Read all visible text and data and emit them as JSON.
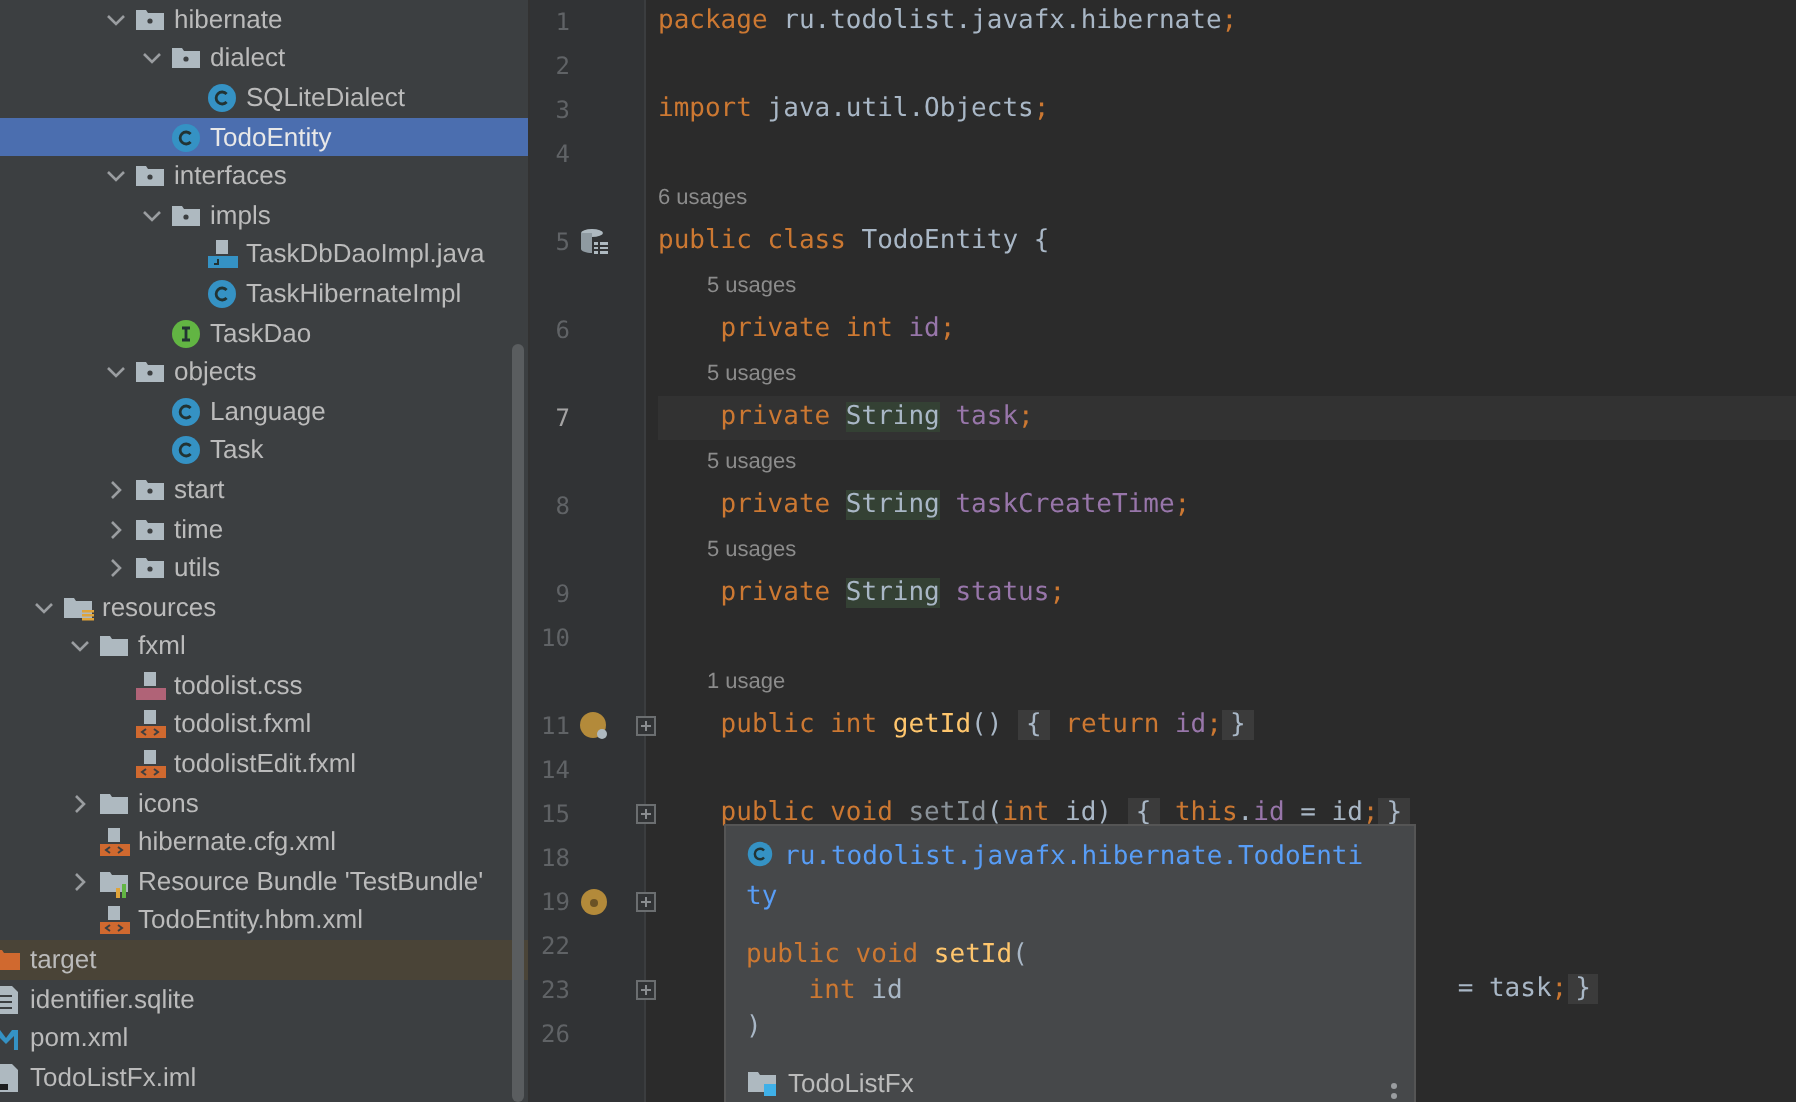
{
  "project_tree": [
    {
      "children": [
        {
          "children": [
            {
              "children": [
                {
                  "children": [
                    {
                      "label": "hibernate",
                      "kind": "package",
                      "expanded": true,
                      "selected": false,
                      "children": [
                        {
                          "label": "dialect",
                          "kind": "package",
                          "expanded": true,
                          "selected": false,
                          "children": [
                            {
                              "label": "SQLiteDialect",
                              "kind": "class",
                              "selected": false
                            }
                          ]
                        },
                        {
                          "label": "TodoEntity",
                          "kind": "class",
                          "selected": true
                        }
                      ]
                    },
                    {
                      "label": "interfaces",
                      "kind": "package",
                      "expanded": true,
                      "selected": false,
                      "children": [
                        {
                          "label": "impls",
                          "kind": "package",
                          "expanded": true,
                          "selected": false,
                          "children": [
                            {
                              "label": "TaskDbDaoImpl.java",
                              "kind": "java-file",
                              "selected": false
                            },
                            {
                              "label": "TaskHibernateImpl",
                              "kind": "class",
                              "selected": false
                            }
                          ]
                        },
                        {
                          "label": "TaskDao",
                          "kind": "interface",
                          "selected": false
                        }
                      ]
                    },
                    {
                      "label": "objects",
                      "kind": "package",
                      "expanded": true,
                      "selected": false,
                      "children": [
                        {
                          "label": "Language",
                          "kind": "class",
                          "selected": false
                        },
                        {
                          "label": "Task",
                          "kind": "class",
                          "selected": false
                        }
                      ]
                    },
                    {
                      "label": "start",
                      "kind": "package",
                      "expanded": false,
                      "selected": false
                    },
                    {
                      "label": "time",
                      "kind": "package",
                      "expanded": false,
                      "selected": false
                    },
                    {
                      "label": "utils",
                      "kind": "package",
                      "expanded": false,
                      "selected": false
                    }
                  ]
                }
              ]
            },
            {
              "label": "resources",
              "kind": "resources-folder",
              "expanded": true,
              "selected": false,
              "children": [
                {
                  "label": "fxml",
                  "kind": "folder",
                  "expanded": true,
                  "selected": false,
                  "children": [
                    {
                      "label": "todolist.css",
                      "kind": "css-file",
                      "selected": false
                    },
                    {
                      "label": "todolist.fxml",
                      "kind": "xml-file",
                      "selected": false
                    },
                    {
                      "label": "todolistEdit.fxml",
                      "kind": "xml-file",
                      "selected": false
                    }
                  ]
                },
                {
                  "label": "icons",
                  "kind": "folder",
                  "expanded": false,
                  "selected": false
                },
                {
                  "label": "hibernate.cfg.xml",
                  "kind": "xml-file",
                  "selected": false
                },
                {
                  "label": "Resource Bundle 'TestBundle'",
                  "kind": "bundle",
                  "expanded": false,
                  "selected": false
                },
                {
                  "label": "TodoEntity.hbm.xml",
                  "kind": "xml-file",
                  "selected": false
                }
              ]
            }
          ]
        }
      ]
    },
    {
      "label": "target",
      "kind": "excluded-folder",
      "selected": false
    },
    {
      "label": "identifier.sqlite",
      "kind": "text-file",
      "selected": false
    },
    {
      "label": "pom.xml",
      "kind": "maven-file",
      "selected": false
    },
    {
      "label": "TodoListFx.iml",
      "kind": "module-file",
      "selected": false
    }
  ],
  "editor": {
    "lines": [
      {
        "number": "1",
        "current": false,
        "folded": false,
        "tokens": [
          {
            "kind": "kw",
            "text": "package"
          },
          {
            "kind": "plain",
            "text": " ru.todolist.javafx.hibernate"
          },
          {
            "kind": "kw",
            "text": ";"
          }
        ]
      },
      {
        "number": "2",
        "current": false,
        "folded": false
      },
      {
        "number": "3",
        "current": false,
        "folded": false,
        "tokens": [
          {
            "kind": "kw",
            "text": "import"
          },
          {
            "kind": "plain",
            "text": " java.util.Objects"
          },
          {
            "kind": "kw",
            "text": ";"
          }
        ]
      },
      {
        "number": "4",
        "current": false,
        "folded": false
      },
      {
        "number": "5",
        "usages": "6 usages",
        "marker": {
          "kind": "table"
        },
        "current": false,
        "folded": false,
        "tokens": [
          {
            "kind": "kw",
            "text": "public class"
          },
          {
            "kind": "plain",
            "text": " TodoEntity {"
          }
        ]
      },
      {
        "number": "6",
        "usages": "5 usages",
        "current": false,
        "folded": false,
        "tokens": [
          {
            "kind": "kw",
            "text": "    private int"
          },
          {
            "kind": "field",
            "text": " id"
          },
          {
            "kind": "kw",
            "text": ";"
          }
        ]
      },
      {
        "number": "7",
        "usages": "5 usages",
        "current": true,
        "folded": false,
        "tokens": [
          {
            "kind": "kw",
            "text": "    private "
          },
          {
            "kind": "type",
            "text": "String"
          },
          {
            "kind": "field",
            "text": " task"
          },
          {
            "kind": "kw",
            "text": ";"
          }
        ]
      },
      {
        "number": "8",
        "usages": "5 usages",
        "current": false,
        "folded": false,
        "tokens": [
          {
            "kind": "kw",
            "text": "    private "
          },
          {
            "kind": "type",
            "text": "String"
          },
          {
            "kind": "field",
            "text": " taskCreateTime"
          },
          {
            "kind": "kw",
            "text": ";"
          }
        ]
      },
      {
        "number": "9",
        "usages": "5 usages",
        "current": false,
        "folded": false,
        "tokens": [
          {
            "kind": "kw",
            "text": "    private "
          },
          {
            "kind": "type",
            "text": "String"
          },
          {
            "kind": "field",
            "text": " status"
          },
          {
            "kind": "kw",
            "text": ";"
          }
        ]
      },
      {
        "number": "10",
        "current": false,
        "folded": false
      },
      {
        "number": "11",
        "usages": "1 usage",
        "marker": {
          "kind": "getter"
        },
        "current": false,
        "folded": true,
        "tokens": [
          {
            "kind": "kw",
            "text": "    public int "
          },
          {
            "kind": "method",
            "text": "getId"
          },
          {
            "kind": "plain",
            "text": "() "
          },
          {
            "kind": "fold",
            "text": "{"
          },
          {
            "kind": "kw",
            "text": " return"
          },
          {
            "kind": "field",
            "text": " id"
          },
          {
            "kind": "kw",
            "text": ";"
          },
          {
            "kind": "fold",
            "text": "}"
          }
        ]
      },
      {
        "number": "14",
        "current": false,
        "folded": false
      },
      {
        "number": "15",
        "current": false,
        "folded": true,
        "tokens": [
          {
            "kind": "kw",
            "text": "    public void "
          },
          {
            "kind": "dim",
            "text": "setId"
          },
          {
            "kind": "plain",
            "text": "("
          },
          {
            "kind": "kw",
            "text": "int"
          },
          {
            "kind": "plain",
            "text": " id) "
          },
          {
            "kind": "fold",
            "text": "{"
          },
          {
            "kind": "kw",
            "text": " this"
          },
          {
            "kind": "plain",
            "text": "."
          },
          {
            "kind": "field",
            "text": "id"
          },
          {
            "kind": "plain",
            "text": " = id"
          },
          {
            "kind": "kw",
            "text": ";"
          },
          {
            "kind": "fold",
            "text": "}"
          }
        ]
      },
      {
        "number": "18",
        "current": false,
        "folded": false
      },
      {
        "number": "19",
        "marker": {
          "kind": "setter"
        },
        "current": false,
        "folded": true
      },
      {
        "number": "22",
        "current": false,
        "folded": false
      },
      {
        "number": "23",
        "current": false,
        "folded": true,
        "tokens": [
          {
            "kind": "after-popup",
            "text": " = task"
          },
          {
            "kind": "kw",
            "text": ";"
          },
          {
            "kind": "fold",
            "text": "}"
          }
        ]
      },
      {
        "number": "26",
        "current": false,
        "folded": false
      }
    ]
  },
  "popup": {
    "qualified_name": "ru.todolist.javafx.hibernate.TodoEntity",
    "signature": [
      [
        {
          "kind": "kw",
          "text": "public void "
        },
        {
          "kind": "method",
          "text": "setId"
        },
        {
          "kind": "plain",
          "text": "("
        }
      ],
      [
        {
          "kind": "kw",
          "text": "    int"
        },
        {
          "kind": "plain",
          "text": " id"
        }
      ],
      [
        {
          "kind": "plain",
          "text": ")"
        }
      ]
    ],
    "module": "TodoListFx"
  }
}
